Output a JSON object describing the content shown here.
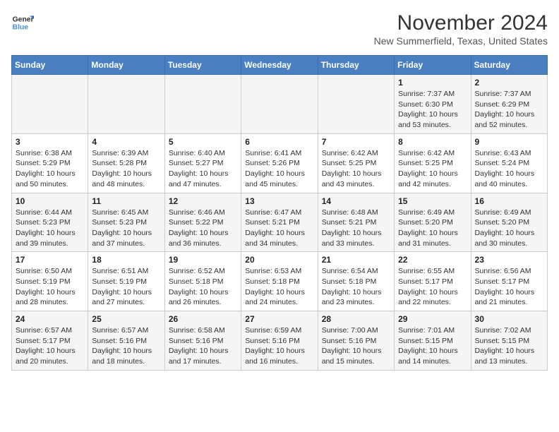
{
  "header": {
    "logo_line1": "General",
    "logo_line2": "Blue",
    "title": "November 2024",
    "subtitle": "New Summerfield, Texas, United States"
  },
  "calendar": {
    "days_of_week": [
      "Sunday",
      "Monday",
      "Tuesday",
      "Wednesday",
      "Thursday",
      "Friday",
      "Saturday"
    ],
    "weeks": [
      [
        {
          "day": "",
          "info": ""
        },
        {
          "day": "",
          "info": ""
        },
        {
          "day": "",
          "info": ""
        },
        {
          "day": "",
          "info": ""
        },
        {
          "day": "",
          "info": ""
        },
        {
          "day": "1",
          "info": "Sunrise: 7:37 AM\nSunset: 6:30 PM\nDaylight: 10 hours and 53 minutes."
        },
        {
          "day": "2",
          "info": "Sunrise: 7:37 AM\nSunset: 6:29 PM\nDaylight: 10 hours and 52 minutes."
        }
      ],
      [
        {
          "day": "3",
          "info": "Sunrise: 6:38 AM\nSunset: 5:29 PM\nDaylight: 10 hours and 50 minutes."
        },
        {
          "day": "4",
          "info": "Sunrise: 6:39 AM\nSunset: 5:28 PM\nDaylight: 10 hours and 48 minutes."
        },
        {
          "day": "5",
          "info": "Sunrise: 6:40 AM\nSunset: 5:27 PM\nDaylight: 10 hours and 47 minutes."
        },
        {
          "day": "6",
          "info": "Sunrise: 6:41 AM\nSunset: 5:26 PM\nDaylight: 10 hours and 45 minutes."
        },
        {
          "day": "7",
          "info": "Sunrise: 6:42 AM\nSunset: 5:25 PM\nDaylight: 10 hours and 43 minutes."
        },
        {
          "day": "8",
          "info": "Sunrise: 6:42 AM\nSunset: 5:25 PM\nDaylight: 10 hours and 42 minutes."
        },
        {
          "day": "9",
          "info": "Sunrise: 6:43 AM\nSunset: 5:24 PM\nDaylight: 10 hours and 40 minutes."
        }
      ],
      [
        {
          "day": "10",
          "info": "Sunrise: 6:44 AM\nSunset: 5:23 PM\nDaylight: 10 hours and 39 minutes."
        },
        {
          "day": "11",
          "info": "Sunrise: 6:45 AM\nSunset: 5:23 PM\nDaylight: 10 hours and 37 minutes."
        },
        {
          "day": "12",
          "info": "Sunrise: 6:46 AM\nSunset: 5:22 PM\nDaylight: 10 hours and 36 minutes."
        },
        {
          "day": "13",
          "info": "Sunrise: 6:47 AM\nSunset: 5:21 PM\nDaylight: 10 hours and 34 minutes."
        },
        {
          "day": "14",
          "info": "Sunrise: 6:48 AM\nSunset: 5:21 PM\nDaylight: 10 hours and 33 minutes."
        },
        {
          "day": "15",
          "info": "Sunrise: 6:49 AM\nSunset: 5:20 PM\nDaylight: 10 hours and 31 minutes."
        },
        {
          "day": "16",
          "info": "Sunrise: 6:49 AM\nSunset: 5:20 PM\nDaylight: 10 hours and 30 minutes."
        }
      ],
      [
        {
          "day": "17",
          "info": "Sunrise: 6:50 AM\nSunset: 5:19 PM\nDaylight: 10 hours and 28 minutes."
        },
        {
          "day": "18",
          "info": "Sunrise: 6:51 AM\nSunset: 5:19 PM\nDaylight: 10 hours and 27 minutes."
        },
        {
          "day": "19",
          "info": "Sunrise: 6:52 AM\nSunset: 5:18 PM\nDaylight: 10 hours and 26 minutes."
        },
        {
          "day": "20",
          "info": "Sunrise: 6:53 AM\nSunset: 5:18 PM\nDaylight: 10 hours and 24 minutes."
        },
        {
          "day": "21",
          "info": "Sunrise: 6:54 AM\nSunset: 5:18 PM\nDaylight: 10 hours and 23 minutes."
        },
        {
          "day": "22",
          "info": "Sunrise: 6:55 AM\nSunset: 5:17 PM\nDaylight: 10 hours and 22 minutes."
        },
        {
          "day": "23",
          "info": "Sunrise: 6:56 AM\nSunset: 5:17 PM\nDaylight: 10 hours and 21 minutes."
        }
      ],
      [
        {
          "day": "24",
          "info": "Sunrise: 6:57 AM\nSunset: 5:17 PM\nDaylight: 10 hours and 20 minutes."
        },
        {
          "day": "25",
          "info": "Sunrise: 6:57 AM\nSunset: 5:16 PM\nDaylight: 10 hours and 18 minutes."
        },
        {
          "day": "26",
          "info": "Sunrise: 6:58 AM\nSunset: 5:16 PM\nDaylight: 10 hours and 17 minutes."
        },
        {
          "day": "27",
          "info": "Sunrise: 6:59 AM\nSunset: 5:16 PM\nDaylight: 10 hours and 16 minutes."
        },
        {
          "day": "28",
          "info": "Sunrise: 7:00 AM\nSunset: 5:16 PM\nDaylight: 10 hours and 15 minutes."
        },
        {
          "day": "29",
          "info": "Sunrise: 7:01 AM\nSunset: 5:15 PM\nDaylight: 10 hours and 14 minutes."
        },
        {
          "day": "30",
          "info": "Sunrise: 7:02 AM\nSunset: 5:15 PM\nDaylight: 10 hours and 13 minutes."
        }
      ]
    ]
  }
}
